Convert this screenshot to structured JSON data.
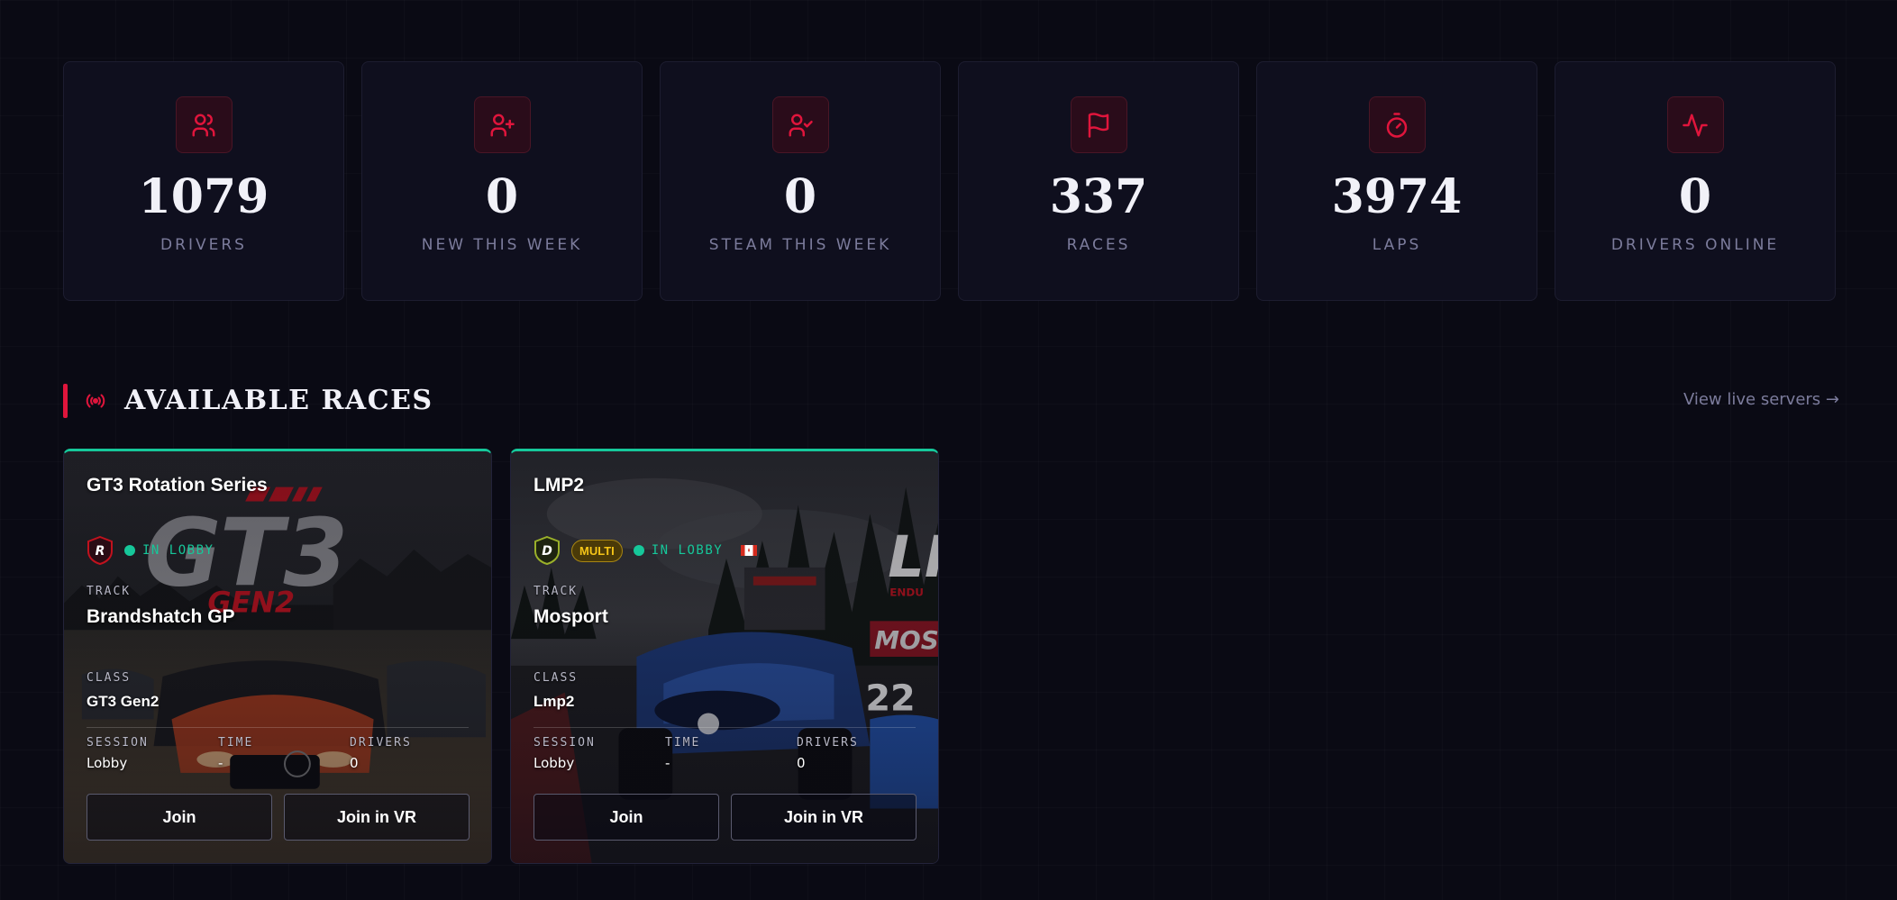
{
  "stats": [
    {
      "icon": "users-icon",
      "value": "1079",
      "label": "DRIVERS"
    },
    {
      "icon": "user-plus-icon",
      "value": "0",
      "label": "NEW THIS WEEK"
    },
    {
      "icon": "user-check-icon",
      "value": "0",
      "label": "STEAM THIS WEEK"
    },
    {
      "icon": "flag-icon",
      "value": "337",
      "label": "RACES"
    },
    {
      "icon": "stopwatch-icon",
      "value": "3974",
      "label": "LAPS"
    },
    {
      "icon": "activity-icon",
      "value": "0",
      "label": "DRIVERS ONLINE"
    }
  ],
  "section": {
    "title": "AVAILABLE RACES",
    "view_live": "View live servers →"
  },
  "labels": {
    "track": "TRACK",
    "class": "CLASS",
    "session": "SESSION",
    "time": "TIME",
    "drivers": "DRIVERS",
    "join": "Join",
    "join_vr": "Join in VR"
  },
  "races": [
    {
      "name": "GT3 Rotation Series",
      "rating": "R",
      "status": "IN LOBBY",
      "track": "Brandshatch GP",
      "class": "GT3 Gen2",
      "session": "Lobby",
      "time": "-",
      "drivers": "0",
      "image_text": "GT3",
      "image_subtext": "GEN2"
    },
    {
      "name": "LMP2",
      "rating": "D",
      "multi": "MULTI",
      "status": "IN LOBBY",
      "track": "Mosport",
      "class": "Lmp2",
      "session": "Lobby",
      "time": "-",
      "drivers": "0",
      "image_text": "LI",
      "image_subtext": "ENDU",
      "banner_text": "MOSI",
      "car_number": "22"
    }
  ],
  "colors": {
    "accent": "#e0153c",
    "online": "#16c79a",
    "multi": "#f5c518",
    "background": "#0a0a14"
  }
}
